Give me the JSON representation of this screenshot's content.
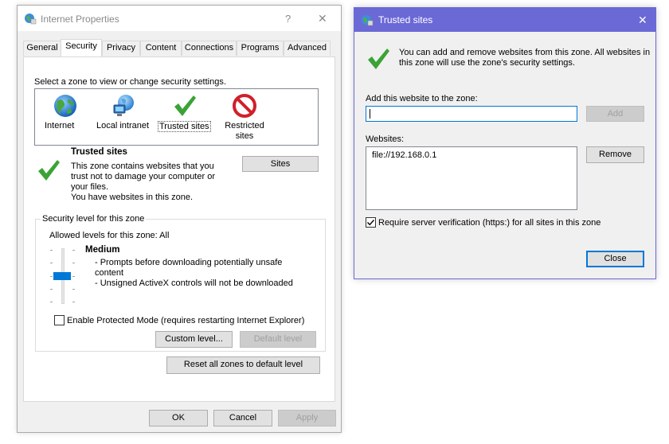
{
  "ie_window": {
    "title": "Internet Properties",
    "help_label": "?",
    "close_label": "✕",
    "tabs": [
      {
        "label": "General"
      },
      {
        "label": "Security"
      },
      {
        "label": "Privacy"
      },
      {
        "label": "Content"
      },
      {
        "label": "Connections"
      },
      {
        "label": "Programs"
      },
      {
        "label": "Advanced"
      }
    ],
    "active_tab": "Security",
    "zone_prompt": "Select a zone to view or change security settings.",
    "zones": [
      {
        "label": "Internet",
        "icon": "globe-icon"
      },
      {
        "label": "Local intranet",
        "icon": "intranet-globe-icon"
      },
      {
        "label": "Trusted sites",
        "icon": "check-icon"
      },
      {
        "label": "Restricted sites",
        "icon": "restricted-icon"
      }
    ],
    "selected_zone": "Trusted sites",
    "zone_info": {
      "title": "Trusted sites",
      "description": "This zone contains websites that you trust not to damage your computer or your files.",
      "has_sites": "You have websites in this zone."
    },
    "sites_button": "Sites",
    "security_level": {
      "group_label": "Security level for this zone",
      "allowed": "Allowed levels for this zone: All",
      "level_name": "Medium",
      "bullets": [
        "- Prompts before downloading potentially unsafe content",
        "- Unsigned ActiveX controls will not be downloaded"
      ],
      "slider_level_index_from_top": 2,
      "slider_levels": 5
    },
    "protected_mode_label": "Enable Protected Mode (requires restarting Internet Explorer)",
    "protected_mode_checked": false,
    "custom_level_button": "Custom level...",
    "default_level_button": "Default level",
    "reset_all_button": "Reset all zones to default level",
    "ok_button": "OK",
    "cancel_button": "Cancel",
    "apply_button": "Apply"
  },
  "trusted_window": {
    "title": "Trusted sites",
    "close_label": "✕",
    "info_text": "You can add and remove websites from this zone. All websites in this zone will use the zone's security settings.",
    "add_label": "Add this website to the zone:",
    "add_value": "",
    "add_button": "Add",
    "websites_label": "Websites:",
    "websites": [
      "file://192.168.0.1"
    ],
    "remove_button": "Remove",
    "require_verification_label": "Require server verification (https:) for all sites in this zone",
    "require_verification_checked": true,
    "close_button": "Close"
  },
  "colors": {
    "accent_titlebar": "#6b69d6",
    "selection_blue": "#0078d7",
    "check_green": "#3aa335",
    "restricted_red": "#d0202a"
  }
}
